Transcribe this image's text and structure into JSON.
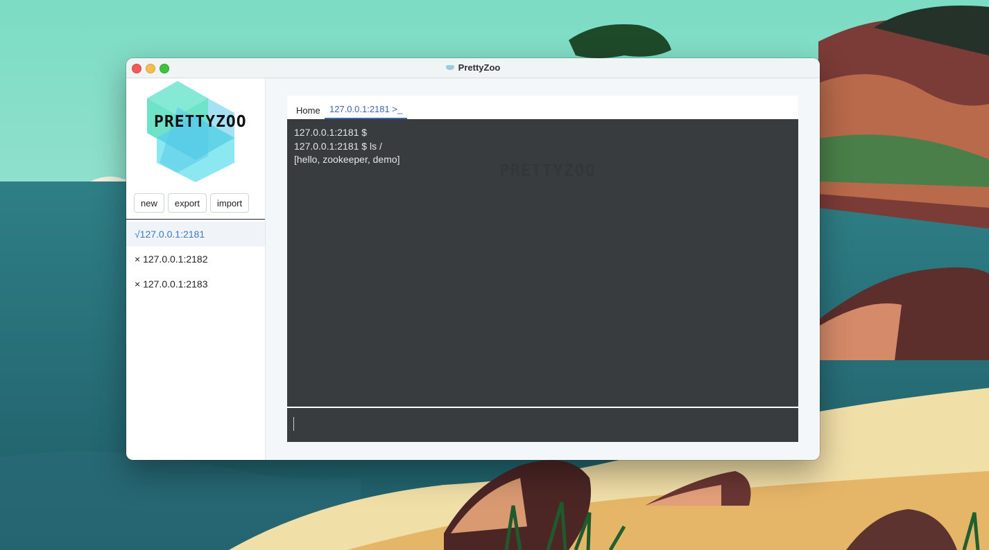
{
  "window": {
    "title": "PrettyZoo"
  },
  "sidebar": {
    "logo_text": "PRETTYZOO",
    "buttons": {
      "new": "new",
      "export": "export",
      "import": "import"
    },
    "servers": [
      {
        "label": "√127.0.0.1:2181",
        "connected": true
      },
      {
        "label": "× 127.0.0.1:2182",
        "connected": false
      },
      {
        "label": "× 127.0.0.1:2183",
        "connected": false
      }
    ]
  },
  "tabs": [
    {
      "label": "Home"
    },
    {
      "label": "127.0.0.1:2181 >_"
    }
  ],
  "terminal": {
    "watermark": "PRETTYZOO",
    "lines": [
      "127.0.0.1:2181  $",
      "127.0.0.1:2181  $     ls /",
      "[hello, zookeeper, demo]"
    ],
    "input_value": ""
  },
  "colors": {
    "accent": "#3b64b8",
    "terminal_bg": "#393c3e",
    "connected": "#3a78c9"
  }
}
